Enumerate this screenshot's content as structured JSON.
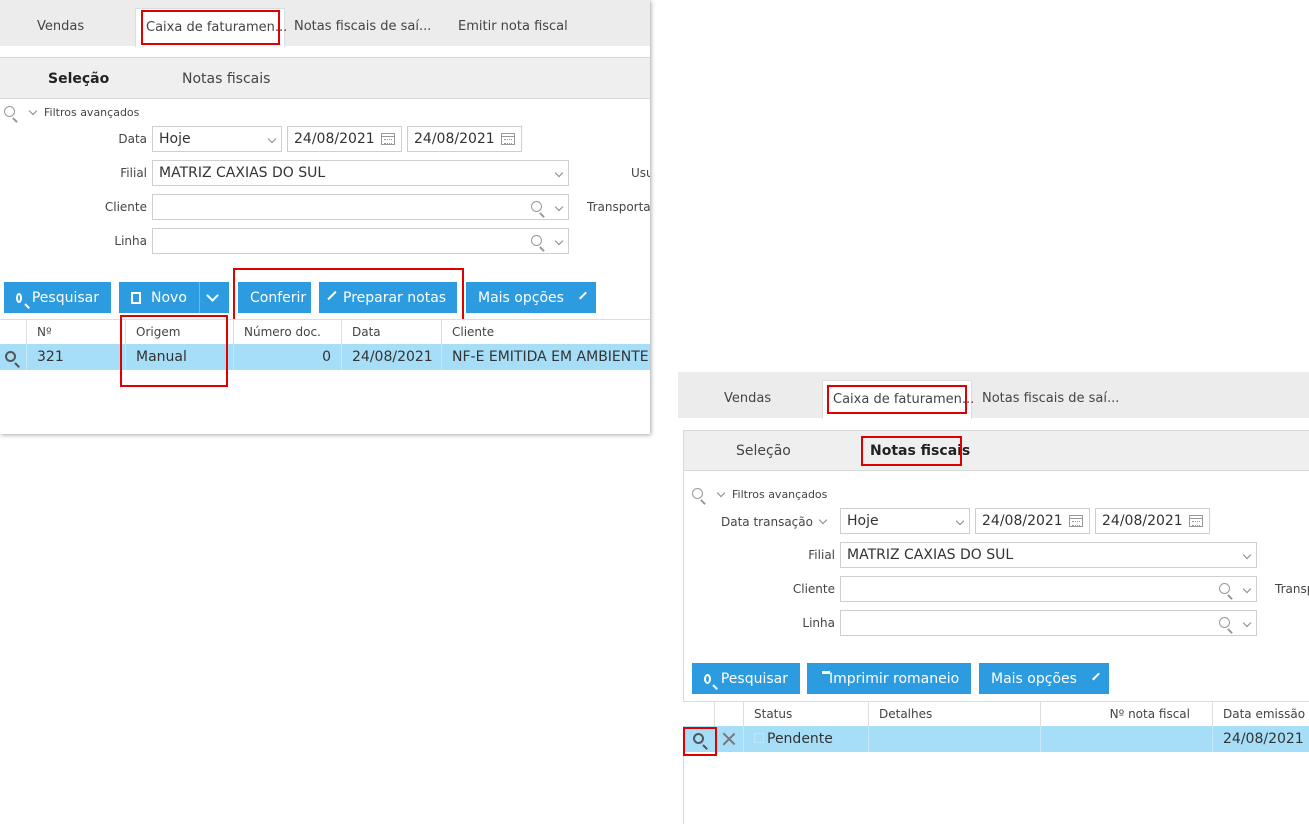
{
  "left": {
    "tabs": [
      "Vendas",
      "Caixa de faturamen...",
      "Notas fiscais de saí...",
      "Emitir nota fiscal"
    ],
    "subtabs": [
      "Seleção",
      "Notas fiscais"
    ],
    "filters_label": "Filtros avançados",
    "data_label": "Data",
    "data_period": "Hoje",
    "date_from": "24/08/2021",
    "date_to": "24/08/2021",
    "filial_label": "Filial",
    "filial_value": "MATRIZ CAXIAS DO SUL",
    "usu_label": "Usu",
    "cliente_label": "Cliente",
    "transporta_label": "Transporta",
    "linha_label": "Linha",
    "buttons": {
      "pesquisar": "Pesquisar",
      "novo": "Novo",
      "conferir": "Conferir",
      "preparar": "Preparar notas",
      "mais": "Mais opções"
    },
    "columns": [
      "Nº",
      "Origem",
      "Número doc.",
      "Data",
      "Cliente"
    ],
    "row": {
      "num": "321",
      "origem": "Manual",
      "numdoc": "0",
      "data": "24/08/2021",
      "cliente": "NF-E EMITIDA EM AMBIENTE DE"
    }
  },
  "right": {
    "tabs": [
      "Vendas",
      "Caixa de faturamen...",
      "Notas fiscais de saí..."
    ],
    "subtabs": [
      "Seleção",
      "Notas fiscais"
    ],
    "filters_label": "Filtros avançados",
    "data_label": "Data transação",
    "data_period": "Hoje",
    "date_from": "24/08/2021",
    "date_to": "24/08/2021",
    "filial_label": "Filial",
    "filial_value": "MATRIZ CAXIAS DO SUL",
    "cliente_label": "Cliente",
    "transp_label": "Transp",
    "linha_label": "Linha",
    "buttons": {
      "pesquisar": "Pesquisar",
      "imprimir": "Imprimir romaneio",
      "mais": "Mais opções"
    },
    "columns": [
      "Status",
      "Detalhes",
      "Nº nota fiscal",
      "Data emissão"
    ],
    "row": {
      "status": "Pendente",
      "detalhes": "",
      "nota": "",
      "emissao": "24/08/2021"
    }
  }
}
